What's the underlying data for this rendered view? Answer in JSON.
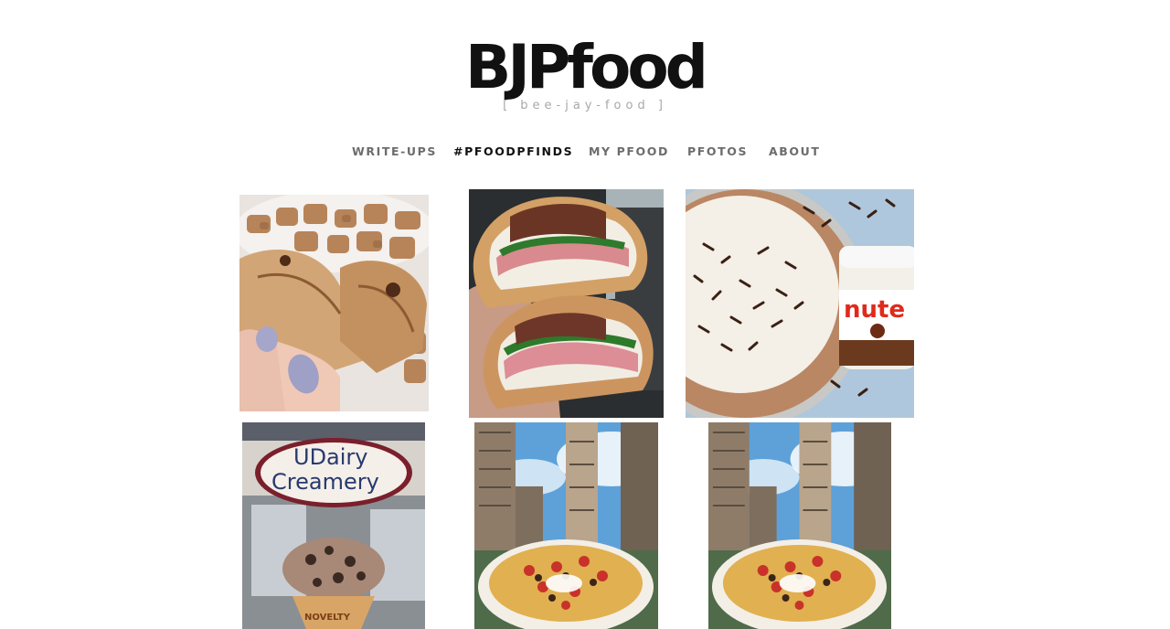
{
  "site": {
    "logo": "BJPfood",
    "tagline": "[ bee-jay-food ]"
  },
  "nav": {
    "items": [
      {
        "label": "WRITE-UPS",
        "active": false
      },
      {
        "label": "#PFOODPFINDS",
        "active": true
      },
      {
        "label": "MY PFOOD",
        "active": false
      },
      {
        "label": "PFOTOS",
        "active": false
      },
      {
        "label": "ABOUT",
        "active": false
      }
    ]
  },
  "photos": {
    "items": [
      {
        "subject": "cinnamon pastry bites held in hand"
      },
      {
        "subject": "deli wrap sandwich halves"
      },
      {
        "subject": "chocolate cream pie with Nutella jar",
        "jar_text": "nute"
      },
      {
        "subject": "ice cream cone at UDairy Creamery",
        "sign_line1": "UDairy",
        "sign_line2": "Creamery",
        "cone_text": "NOVELTY"
      },
      {
        "subject": "nachos in front of Flatiron Building"
      },
      {
        "subject": "nachos in front of Flatiron Building"
      }
    ]
  }
}
